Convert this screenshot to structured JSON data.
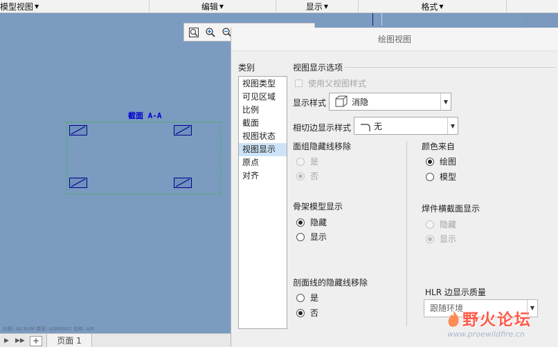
{
  "ribbon": {
    "groups": [
      {
        "label": "模型视图"
      },
      {
        "label": "编辑"
      },
      {
        "label": "显示"
      },
      {
        "label": "格式"
      }
    ]
  },
  "canvas": {
    "section_label": "截面 A-A",
    "status_text": "比例: A0.9UM    类型: ASM0001    名称: AIR"
  },
  "sheets": {
    "tab_label": "页面 1",
    "add_label": "+"
  },
  "dialog": {
    "title": "绘图视图",
    "category_header": "类别",
    "categories": [
      "视图类型",
      "可见区域",
      "比例",
      "截面",
      "视图状态",
      "视图显示",
      "原点",
      "对齐"
    ],
    "selected_category": "视图显示",
    "options_header": "视图显示选项",
    "use_parent_label": "使用父视图样式",
    "display_style_label": "显示样式",
    "display_style_value": "消隐",
    "tangent_label": "相切边显示样式",
    "tangent_value": "无",
    "face_hidden_title": "面组隐藏线移除",
    "face_hidden_yes": "是",
    "face_hidden_no": "否",
    "skeleton_title": "骨架模型显示",
    "skeleton_hide": "隐藏",
    "skeleton_show": "显示",
    "xsec_hidden_title": "剖面线的隐藏线移除",
    "xsec_yes": "是",
    "xsec_no": "否",
    "color_from_title": "颜色来自",
    "color_drawing": "绘图",
    "color_model": "模型",
    "weld_title": "焊件横截面显示",
    "weld_hide": "隐藏",
    "weld_show": "显示",
    "hlr_title": "HLR 边显示质量",
    "hlr_value": "跟随环境"
  },
  "watermark": {
    "main": "野火论坛",
    "url": "www.proewildfire.cn"
  },
  "colors": {
    "canvas": "#7b9bc0",
    "selection": "#cde3f7",
    "section_label": "#0000cc",
    "frame_dash": "#3bb84a",
    "watermark": "#ff5a4a"
  }
}
